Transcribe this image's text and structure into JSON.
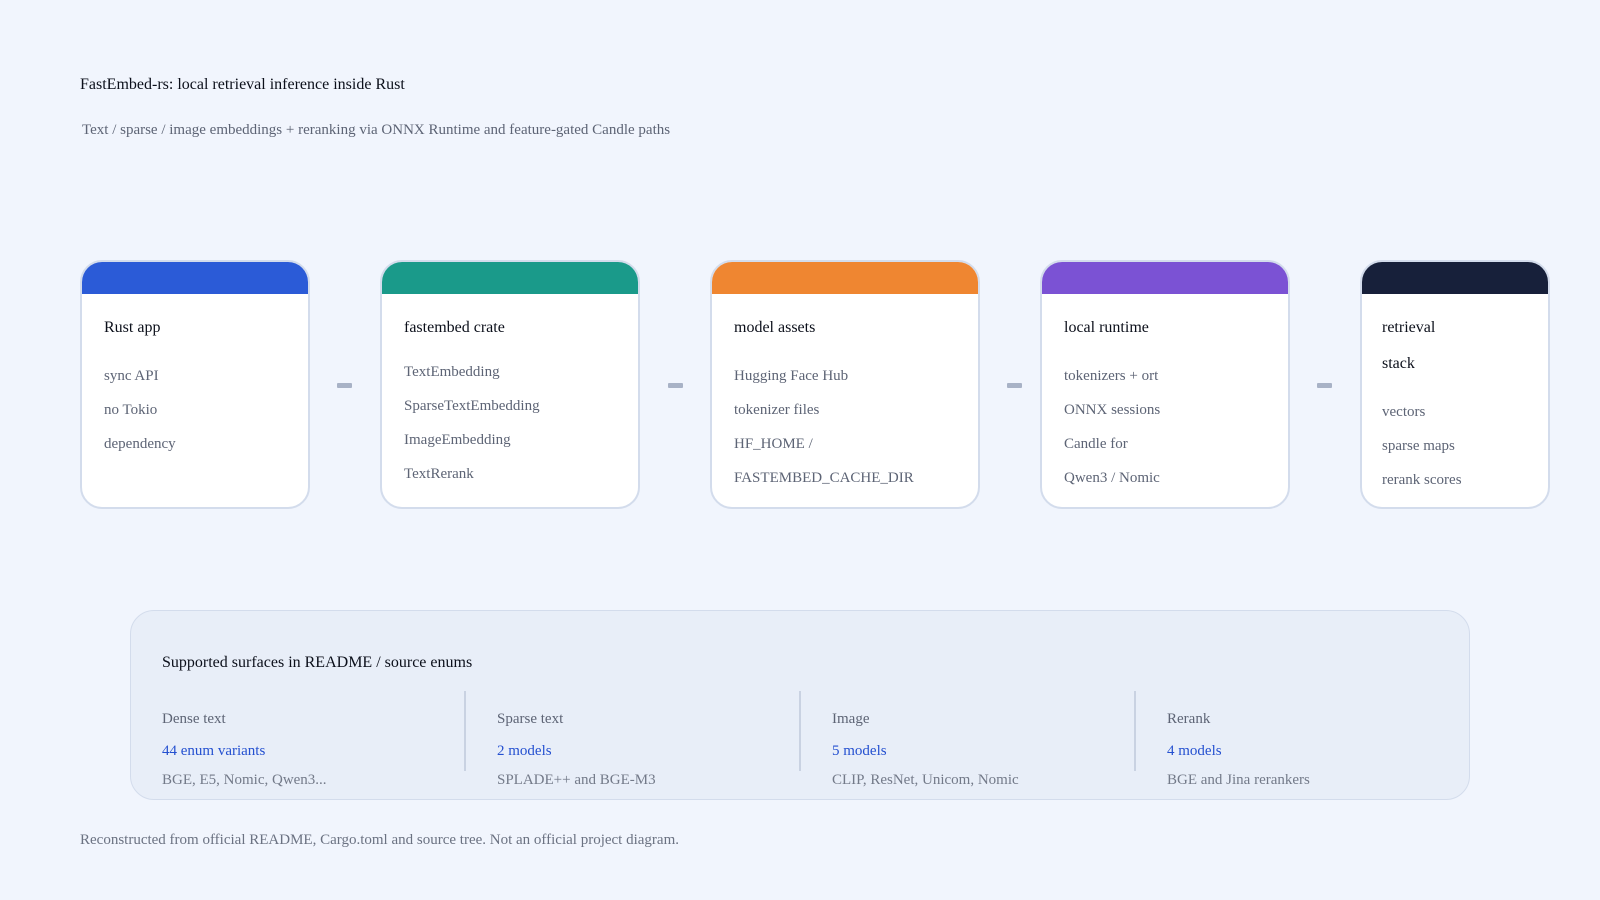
{
  "header": {
    "title": "FastEmbed-rs: local retrieval inference inside Rust",
    "subtitle": "Text / sparse / image embeddings + reranking via ONNX Runtime and feature-gated Candle paths"
  },
  "pipeline": [
    {
      "title": "Rust app",
      "color": "#2b5bd7",
      "lines": [
        "sync API",
        "no Tokio",
        "dependency"
      ]
    },
    {
      "title": "fastembed crate",
      "color": "#1a9a8a",
      "lines": [
        "TextEmbedding",
        "SparseTextEmbedding",
        "ImageEmbedding",
        "TextRerank"
      ]
    },
    {
      "title": "model assets",
      "color": "#ef8631",
      "lines": [
        "Hugging Face Hub",
        "tokenizer files",
        "HF_HOME /",
        "FASTEMBED_CACHE_DIR"
      ]
    },
    {
      "title": "local runtime",
      "color": "#7b52d4",
      "lines": [
        "tokenizers + ort",
        "ONNX sessions",
        "Candle for",
        "Qwen3 / Nomic"
      ]
    },
    {
      "title": "retrieval",
      "title2": "stack",
      "color": "#17203a",
      "lines": [
        "vectors",
        "sparse maps",
        "rerank scores"
      ]
    }
  ],
  "surfaces": {
    "title": "Supported surfaces in README / source enums",
    "accent": "#2450d0",
    "columns": [
      {
        "label": "Dense text",
        "value": "44 enum variants",
        "desc": "BGE, E5, Nomic, Qwen3..."
      },
      {
        "label": "Sparse text",
        "value": "2 models",
        "desc": "SPLADE++ and BGE-M3"
      },
      {
        "label": "Image",
        "value": "5 models",
        "desc": "CLIP, ResNet, Unicom, Nomic"
      },
      {
        "label": "Rerank",
        "value": "4 models",
        "desc": "BGE and Jina rerankers"
      }
    ]
  },
  "footer": "Reconstructed from official README, Cargo.toml and source tree. Not an official project diagram."
}
